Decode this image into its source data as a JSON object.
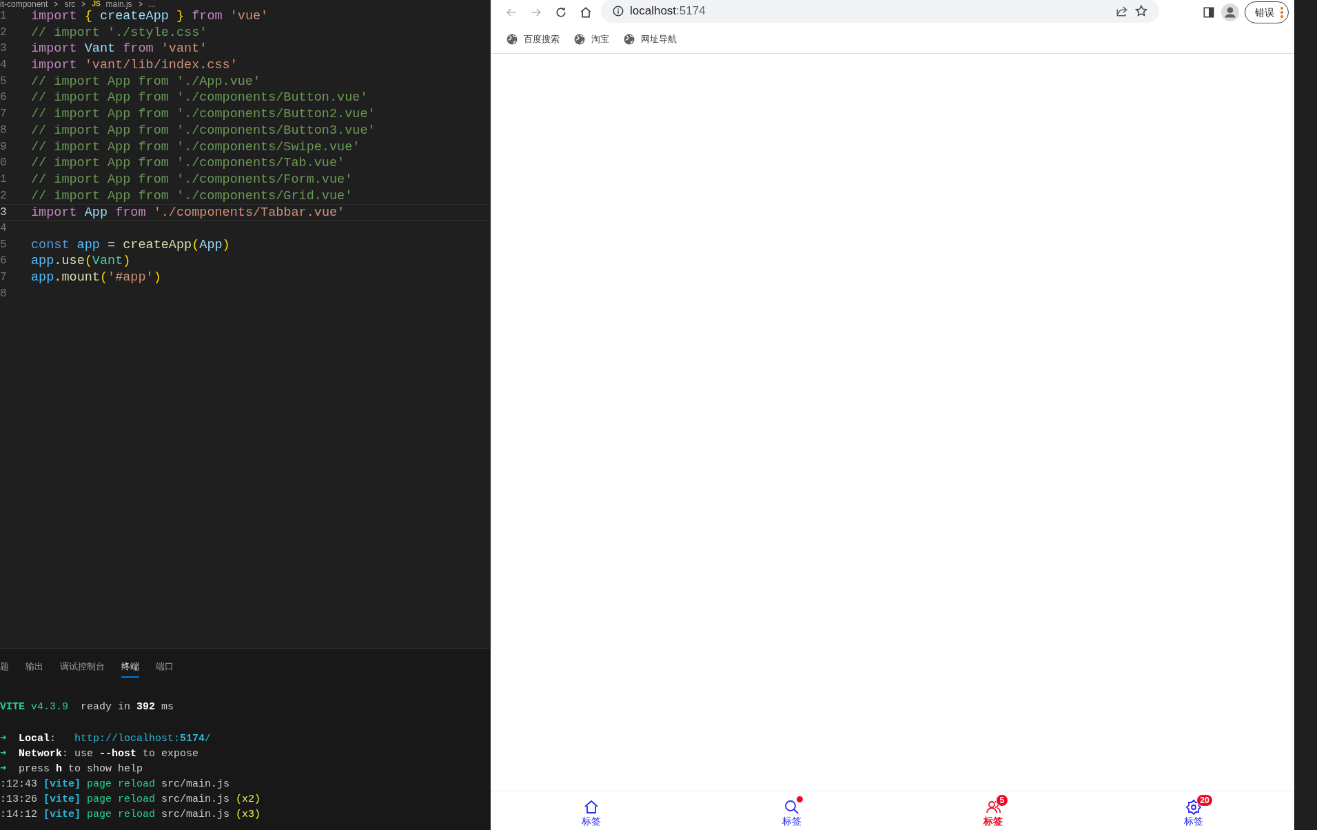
{
  "editor": {
    "breadcrumb": [
      {
        "text": "it-component"
      },
      {
        "text": "src"
      },
      {
        "badge": "JS",
        "text": "main.js"
      },
      {
        "text": "..."
      }
    ],
    "lines": [
      {
        "number": "1",
        "current": false,
        "tokens": [
          {
            "kind": "kw",
            "text": "import"
          },
          {
            "kind": "br",
            "text": " {"
          },
          {
            "kind": "var",
            "text": " createApp"
          },
          {
            "kind": "br",
            "text": " }"
          },
          {
            "kind": "kw",
            "text": " from"
          },
          {
            "kind": "str",
            "text": " 'vue'"
          }
        ]
      },
      {
        "number": "2",
        "current": false,
        "tokens": [
          {
            "kind": "com",
            "text": "// import './style.css'"
          }
        ]
      },
      {
        "number": "3",
        "current": false,
        "tokens": [
          {
            "kind": "kw",
            "text": "import"
          },
          {
            "kind": "var",
            "text": " Vant"
          },
          {
            "kind": "kw",
            "text": " from"
          },
          {
            "kind": "str",
            "text": " 'vant'"
          }
        ]
      },
      {
        "number": "4",
        "current": false,
        "tokens": [
          {
            "kind": "kw",
            "text": "import"
          },
          {
            "kind": "str",
            "text": " 'vant/lib/index.css'"
          }
        ]
      },
      {
        "number": "5",
        "current": false,
        "tokens": [
          {
            "kind": "com",
            "text": "// import App from './App.vue'"
          }
        ]
      },
      {
        "number": "6",
        "current": false,
        "tokens": [
          {
            "kind": "com",
            "text": "// import App from './components/Button.vue'"
          }
        ]
      },
      {
        "number": "7",
        "current": false,
        "tokens": [
          {
            "kind": "com",
            "text": "// import App from './components/Button2.vue'"
          }
        ]
      },
      {
        "number": "8",
        "current": false,
        "tokens": [
          {
            "kind": "com",
            "text": "// import App from './components/Button3.vue'"
          }
        ]
      },
      {
        "number": "9",
        "current": false,
        "tokens": [
          {
            "kind": "com",
            "text": "// import App from './components/Swipe.vue'"
          }
        ]
      },
      {
        "number": "0",
        "current": false,
        "tokens": [
          {
            "kind": "com",
            "text": "// import App from './components/Tab.vue'"
          }
        ]
      },
      {
        "number": "1",
        "current": false,
        "tokens": [
          {
            "kind": "com",
            "text": "// import App from './components/Form.vue'"
          }
        ]
      },
      {
        "number": "2",
        "current": false,
        "tokens": [
          {
            "kind": "com",
            "text": "// import App from './components/Grid.vue'"
          }
        ]
      },
      {
        "number": "3",
        "current": true,
        "tokens": [
          {
            "kind": "kw",
            "text": "import"
          },
          {
            "kind": "var",
            "text": " App"
          },
          {
            "kind": "kw",
            "text": " from"
          },
          {
            "kind": "str",
            "text": " './components/Tabbar.vue'"
          }
        ]
      },
      {
        "number": "4",
        "current": false
      },
      {
        "number": "5",
        "current": false,
        "tokens": [
          {
            "kind": "sto",
            "text": "const"
          },
          {
            "kind": "cvar",
            "text": " app"
          },
          {
            "kind": "plain",
            "text": " = "
          },
          {
            "kind": "fn",
            "text": "createApp"
          },
          {
            "kind": "br",
            "text": "("
          },
          {
            "kind": "var",
            "text": "App"
          },
          {
            "kind": "br",
            "text": ")"
          }
        ]
      },
      {
        "number": "6",
        "current": false,
        "tokens": [
          {
            "kind": "cvar",
            "text": "app"
          },
          {
            "kind": "plain",
            "text": "."
          },
          {
            "kind": "fn",
            "text": "use"
          },
          {
            "kind": "br",
            "text": "("
          },
          {
            "kind": "cls",
            "text": "Vant"
          },
          {
            "kind": "br",
            "text": ")"
          }
        ]
      },
      {
        "number": "7",
        "current": false,
        "tokens": [
          {
            "kind": "cvar",
            "text": "app"
          },
          {
            "kind": "plain",
            "text": "."
          },
          {
            "kind": "fn",
            "text": "mount"
          },
          {
            "kind": "br",
            "text": "("
          },
          {
            "kind": "str",
            "text": "'#app'"
          },
          {
            "kind": "br",
            "text": ")"
          }
        ]
      },
      {
        "number": "8",
        "current": false
      }
    ]
  },
  "panel": {
    "tabs": [
      {
        "label": "题",
        "selected": false
      },
      {
        "label": "输出",
        "selected": false
      },
      {
        "label": "调试控制台",
        "selected": false
      },
      {
        "label": "终端",
        "selected": true
      },
      {
        "label": "端口",
        "selected": false
      }
    ],
    "terminal": [
      {
        "lines": [
          {
            "segments": [
              {
                "kind": "gb",
                "text": "VITE"
              },
              {
                "kind": "g",
                "text": " v4.3.9"
              },
              {
                "kind": "plain",
                "text": "  ready in"
              },
              {
                "kind": "b",
                "text": " 392"
              },
              {
                "kind": "plain",
                "text": " ms"
              }
            ]
          }
        ]
      },
      {
        "lines": [
          {
            "segments": [
              {
                "kind": "g",
                "text": "➜"
              },
              {
                "kind": "b",
                "text": "  Local"
              },
              {
                "kind": "plain",
                "text": ":"
              },
              {
                "kind": "c",
                "text": "   http://localhost:"
              },
              {
                "kind": "cb",
                "text": "5174"
              },
              {
                "kind": "c",
                "text": "/"
              }
            ]
          },
          {
            "segments": [
              {
                "kind": "g",
                "text": "➜"
              },
              {
                "kind": "b",
                "text": "  Network"
              },
              {
                "kind": "plain",
                "text": ": use"
              },
              {
                "kind": "b",
                "text": " --host"
              },
              {
                "kind": "plain",
                "text": " to expose"
              }
            ]
          },
          {
            "segments": [
              {
                "kind": "g",
                "text": "➜"
              },
              {
                "kind": "plain",
                "text": "  press"
              },
              {
                "kind": "b",
                "text": " h"
              },
              {
                "kind": "plain",
                "text": " to show help"
              }
            ]
          },
          {
            "segments": [
              {
                "kind": "plain",
                "text": ":12:43"
              },
              {
                "kind": "cb",
                "text": " [vite]"
              },
              {
                "kind": "g",
                "text": " page reload"
              },
              {
                "kind": "plain",
                "text": " src/main.js"
              }
            ]
          },
          {
            "segments": [
              {
                "kind": "plain",
                "text": ":13:26"
              },
              {
                "kind": "cb",
                "text": " [vite]"
              },
              {
                "kind": "g",
                "text": " page reload"
              },
              {
                "kind": "plain",
                "text": " src/main.js"
              },
              {
                "kind": "y",
                "text": " (x2)"
              }
            ]
          },
          {
            "segments": [
              {
                "kind": "plain",
                "text": ":14:12"
              },
              {
                "kind": "cb",
                "text": " [vite]"
              },
              {
                "kind": "g",
                "text": " page reload"
              },
              {
                "kind": "plain",
                "text": " src/main.js"
              },
              {
                "kind": "y",
                "text": " (x3)"
              }
            ]
          }
        ]
      }
    ]
  },
  "browser": {
    "nav": [
      {
        "kind": "back",
        "disabled": true
      },
      {
        "kind": "forward",
        "disabled": true
      },
      {
        "kind": "reload",
        "disabled": false
      },
      {
        "kind": "home",
        "disabled": false
      }
    ],
    "address": {
      "host": "localhost",
      "port": ":5174"
    },
    "profile_button": "错误",
    "bookmarks": [
      {
        "label": "百度搜索"
      },
      {
        "label": "淘宝"
      },
      {
        "label": "网址导航"
      }
    ],
    "tabbar": [
      {
        "kind": "home",
        "label": "标签",
        "selected": false
      },
      {
        "kind": "search",
        "label": "标签",
        "selected": false,
        "dot": true
      },
      {
        "kind": "friends",
        "label": "标签",
        "selected": true,
        "badge": "5"
      },
      {
        "kind": "setting",
        "label": "标签",
        "selected": false,
        "badge": "20"
      }
    ]
  }
}
